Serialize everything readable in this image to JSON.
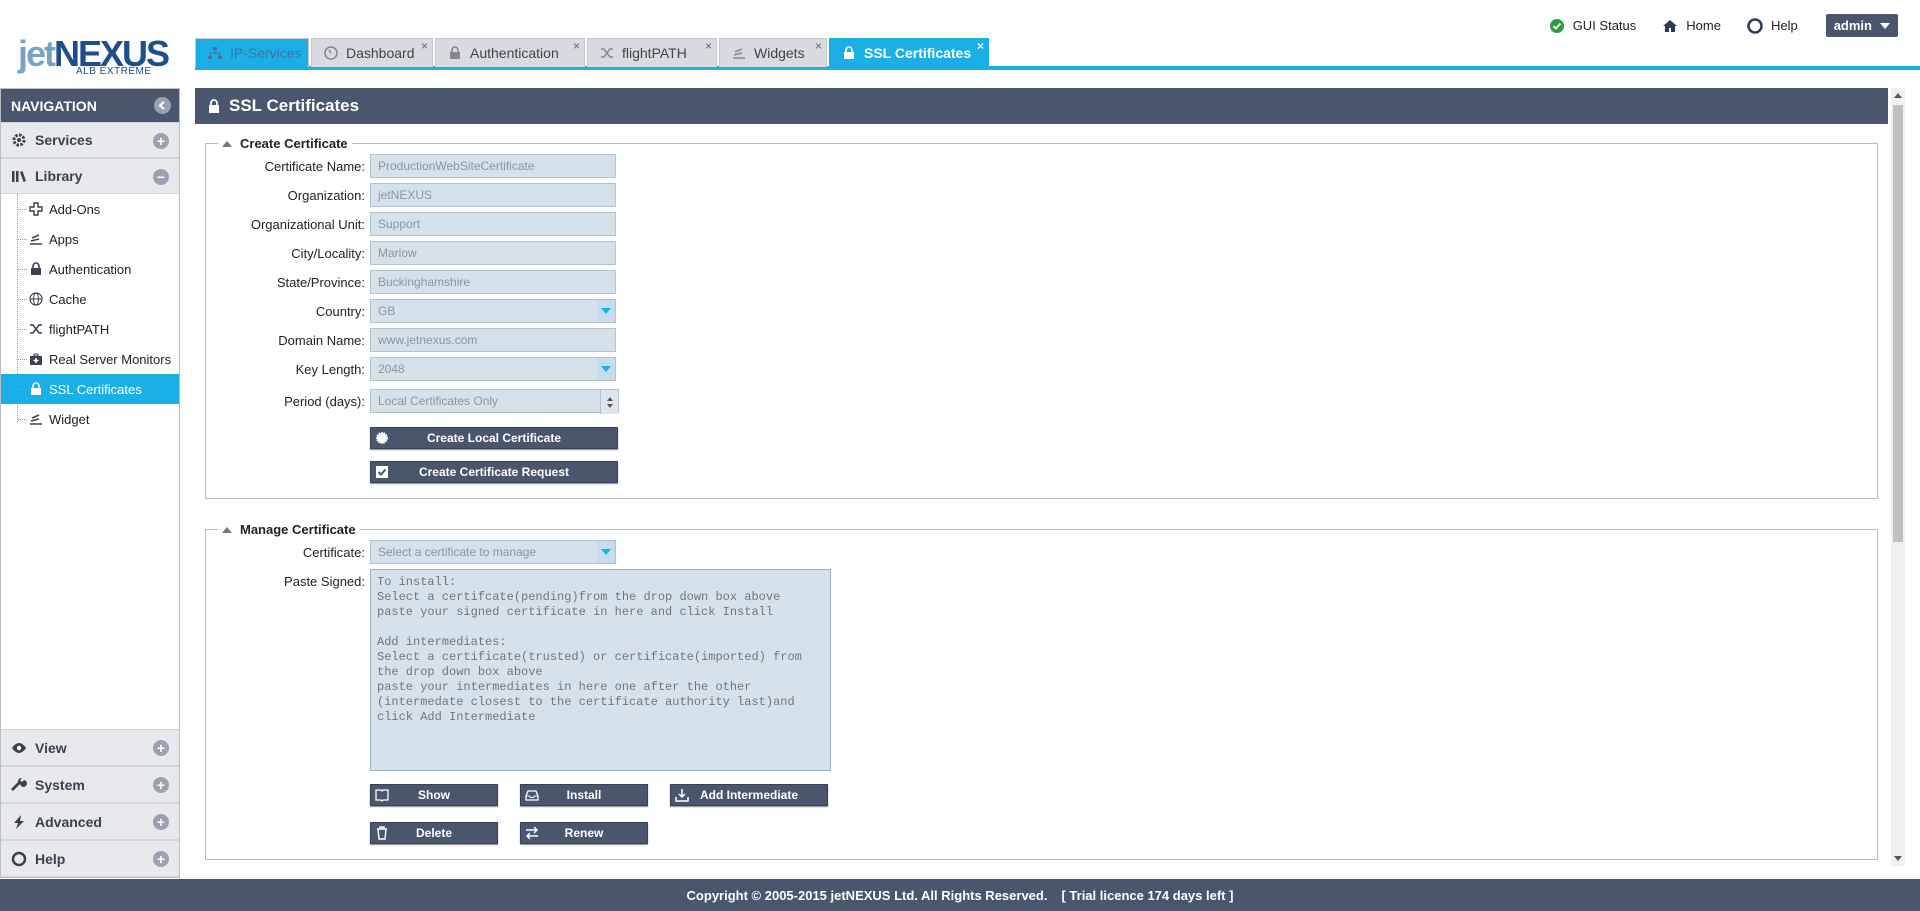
{
  "brand": {
    "name_a": "jet",
    "name_b": "NEXUS",
    "tagline": "ALB EXTREME"
  },
  "topnav": {
    "gui_status": "GUI Status",
    "home": "Home",
    "help": "Help",
    "user": "admin"
  },
  "tabs": [
    {
      "label": "IP-Services",
      "icon": "network-icon"
    },
    {
      "label": "Dashboard",
      "icon": "gauge-icon",
      "close": "×"
    },
    {
      "label": "Authentication",
      "icon": "lock-icon",
      "close": "×"
    },
    {
      "label": "flightPATH",
      "icon": "shuffle-icon",
      "close": "×"
    },
    {
      "label": "Widgets",
      "icon": "widget-icon",
      "close": "×"
    },
    {
      "label": "SSL Certificates",
      "icon": "lock-icon",
      "close": "×"
    }
  ],
  "sidebar": {
    "title": "NAVIGATION",
    "sections": {
      "services": "Services",
      "library": "Library",
      "view": "View",
      "system": "System",
      "advanced": "Advanced",
      "help": "Help"
    },
    "library_items": [
      {
        "label": "Add-Ons",
        "icon": "puzzle-icon"
      },
      {
        "label": "Apps",
        "icon": "stack-icon"
      },
      {
        "label": "Authentication",
        "icon": "lock-icon"
      },
      {
        "label": "Cache",
        "icon": "globe-icon"
      },
      {
        "label": "flightPATH",
        "icon": "shuffle-icon"
      },
      {
        "label": "Real Server Monitors",
        "icon": "medkit-icon"
      },
      {
        "label": "SSL Certificates",
        "icon": "lock-icon",
        "active": true
      },
      {
        "label": "Widget",
        "icon": "widget-icon"
      }
    ]
  },
  "panel": {
    "title": "SSL Certificates"
  },
  "create": {
    "legend": "Create Certificate",
    "fields": {
      "name": {
        "label": "Certificate Name:",
        "value": "ProductionWebSiteCertificate"
      },
      "org": {
        "label": "Organization:",
        "value": "jetNEXUS"
      },
      "unit": {
        "label": "Organizational Unit:",
        "value": "Support"
      },
      "city": {
        "label": "City/Locality:",
        "value": "Marlow"
      },
      "state": {
        "label": "State/Province:",
        "value": "Buckinghamshire"
      },
      "country": {
        "label": "Country:",
        "value": "GB"
      },
      "domain": {
        "label": "Domain Name:",
        "value": "www.jetnexus.com"
      },
      "keylen": {
        "label": "Key Length:",
        "value": "2048"
      },
      "period": {
        "label": "Period (days):",
        "value": "Local Certificates Only"
      }
    },
    "btn_local": "Create Local Certificate",
    "btn_request": "Create Certificate Request"
  },
  "manage": {
    "legend": "Manage Certificate",
    "cert_label": "Certificate:",
    "cert_placeholder": "Select a certificate to manage",
    "paste_label": "Paste Signed:",
    "paste_placeholder": "To install:\nSelect a certifcate(pending)from the drop down box above\npaste your signed certificate in here and click Install\n\nAdd intermediates:\nSelect a certificate(trusted) or certificate(imported) from the drop down box above\npaste your intermediates in here one after the other (intermedate closest to the certificate authority last)and click Add Intermediate",
    "btn_show": "Show",
    "btn_install": "Install",
    "btn_add_intermediate": "Add Intermediate",
    "btn_delete": "Delete",
    "btn_renew": "Renew"
  },
  "footer": {
    "copyright": "Copyright © 2005-2015 jetNEXUS Ltd. All Rights Reserved.",
    "licence": "[ Trial licence 174 days left ]"
  },
  "colors": {
    "accent": "#1ab0e5",
    "header": "#4a566e",
    "input_bg": "#d5e2ec"
  }
}
